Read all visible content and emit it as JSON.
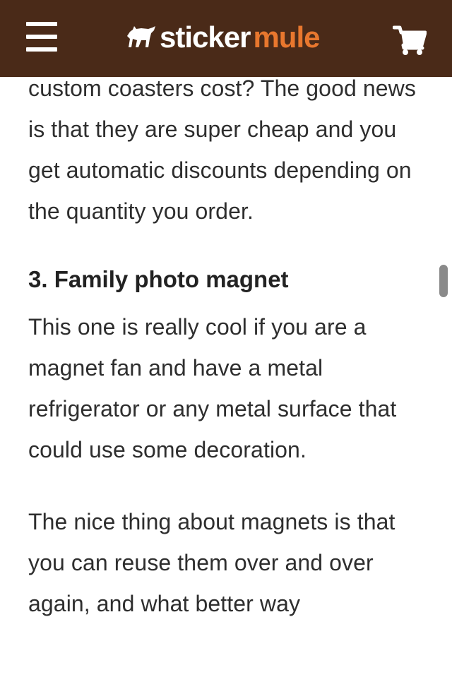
{
  "header": {
    "menu_icon": "hamburger-menu-icon",
    "logo": {
      "part1": "sticker",
      "part2": "mule",
      "icon": "mule-logo-icon",
      "accent_color": "#e8772e"
    },
    "cart_icon": "shopping-cart-icon",
    "background_color": "#4a2a18"
  },
  "article": {
    "intro_text": "custom coasters cost? The good news is that they are super cheap and you get automatic discounts depending on the quantity you order.",
    "section_heading": "3. Family photo magnet",
    "paragraph_1": "This one is really cool if you are a magnet fan and have a metal refrigerator or any metal surface that could use some decoration.",
    "paragraph_2": "The nice thing about magnets is that you can reuse them over and over again, and what better way"
  }
}
